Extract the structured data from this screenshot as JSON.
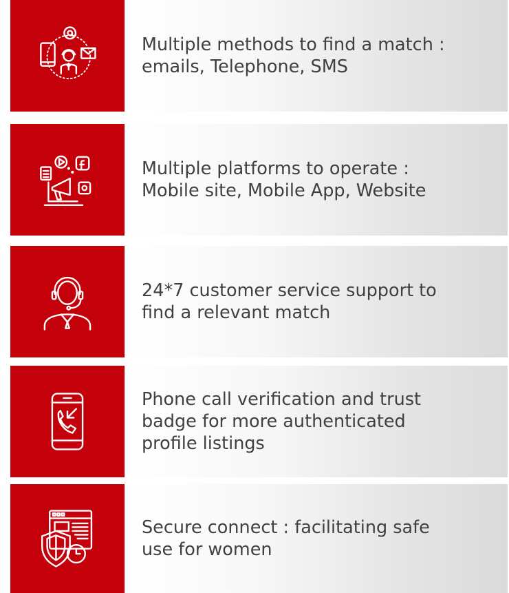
{
  "features": [
    {
      "icon": "contact-methods-icon",
      "text": "Multiple methods to find a match :\nemails, Telephone, SMS"
    },
    {
      "icon": "marketing-platforms-icon",
      "text": "Multiple platforms to operate :\nMobile site, Mobile App, Website"
    },
    {
      "icon": "customer-support-agent-icon",
      "text": "24*7 customer service support to\nfind a relevant match"
    },
    {
      "icon": "phone-call-verification-icon",
      "text": "Phone call verification and trust\nbadge  for more authenticated\nprofile listings"
    },
    {
      "icon": "secure-connect-shield-icon",
      "text": "Secure connect : facilitating safe\nuse for women"
    }
  ],
  "colors": {
    "tile": "#c4000b",
    "text": "#404040"
  }
}
